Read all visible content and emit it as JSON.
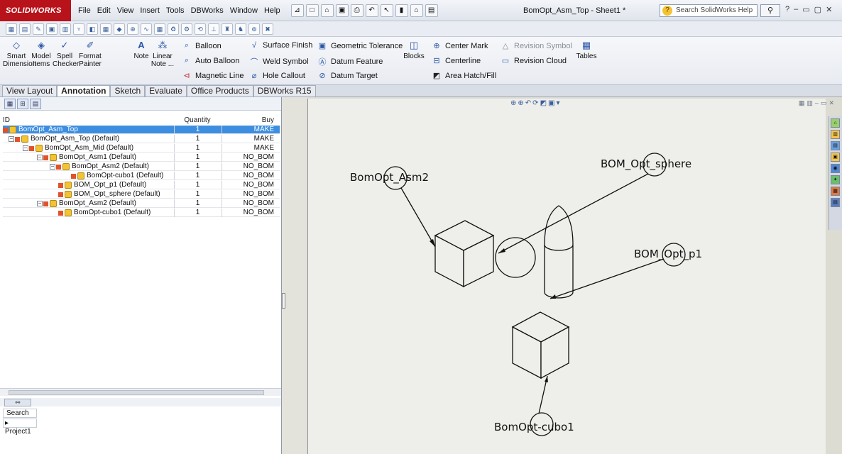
{
  "app": {
    "logo": "SOLIDWORKS",
    "doc_title": "BomOpt_Asm_Top - Sheet1 *"
  },
  "menu": [
    "File",
    "Edit",
    "View",
    "Insert",
    "Tools",
    "DBWorks",
    "Window",
    "Help"
  ],
  "search": {
    "placeholder": "Search SolidWorks Help"
  },
  "ribbon": {
    "smart_dimension": "Smart Dimension",
    "model_items": "Model Items",
    "spell_checker": "Spell Checker",
    "format_painter": "Format Painter",
    "note": "Note",
    "linear_note": "Linear Note ...",
    "balloon": "Balloon",
    "auto_balloon": "Auto Balloon",
    "magnetic_line": "Magnetic Line",
    "surface_finish": "Surface Finish",
    "weld_symbol": "Weld Symbol",
    "hole_callout": "Hole Callout",
    "geometric_tolerance": "Geometric Tolerance",
    "datum_feature": "Datum Feature",
    "datum_target": "Datum Target",
    "blocks": "Blocks",
    "center_mark": "Center Mark",
    "centerline": "Centerline",
    "area_hatch": "Area Hatch/Fill",
    "revision_symbol": "Revision Symbol",
    "revision_cloud": "Revision Cloud",
    "tables": "Tables"
  },
  "tabs": [
    "View Layout",
    "Annotation",
    "Sketch",
    "Evaluate",
    "Office Products",
    "DBWorks R15"
  ],
  "active_tab": "Annotation",
  "bom": {
    "headers": {
      "id": "ID",
      "quantity": "Quantity",
      "buy": "Buy"
    },
    "rows": [
      {
        "id": "BomOpt_Asm_Top",
        "quantity": "1",
        "buy": "MAKE"
      },
      {
        "id": "BomOpt_Asm_Top (Default)",
        "quantity": "1",
        "buy": "MAKE"
      },
      {
        "id": "BomOpt_Asm_Mid (Default)",
        "quantity": "1",
        "buy": "MAKE"
      },
      {
        "id": "BomOpt_Asm1 (Default)",
        "quantity": "1",
        "buy": "NO_BOM"
      },
      {
        "id": "BomOpt_Asm2 (Default)",
        "quantity": "1",
        "buy": "NO_BOM"
      },
      {
        "id": "BomOpt-cubo1 (Default)",
        "quantity": "1",
        "buy": "NO_BOM"
      },
      {
        "id": "BOM_Opt_p1 (Default)",
        "quantity": "1",
        "buy": "NO_BOM"
      },
      {
        "id": "BOM_Opt_sphere (Default)",
        "quantity": "1",
        "buy": "NO_BOM"
      },
      {
        "id": "BomOpt_Asm2 (Default)",
        "quantity": "1",
        "buy": "NO_BOM"
      },
      {
        "id": "BomOpt-cubo1 (Default)",
        "quantity": "1",
        "buy": "NO_BOM"
      }
    ]
  },
  "search_pane": {
    "search_label": "Search",
    "project": "Project1"
  },
  "drawing": {
    "balloons": {
      "asm2": "BomOpt_Asm2",
      "sphere": "BOM_Opt_sphere",
      "p1": "BOM_Opt_p1",
      "cubo1": "BomOpt-cubo1"
    }
  }
}
